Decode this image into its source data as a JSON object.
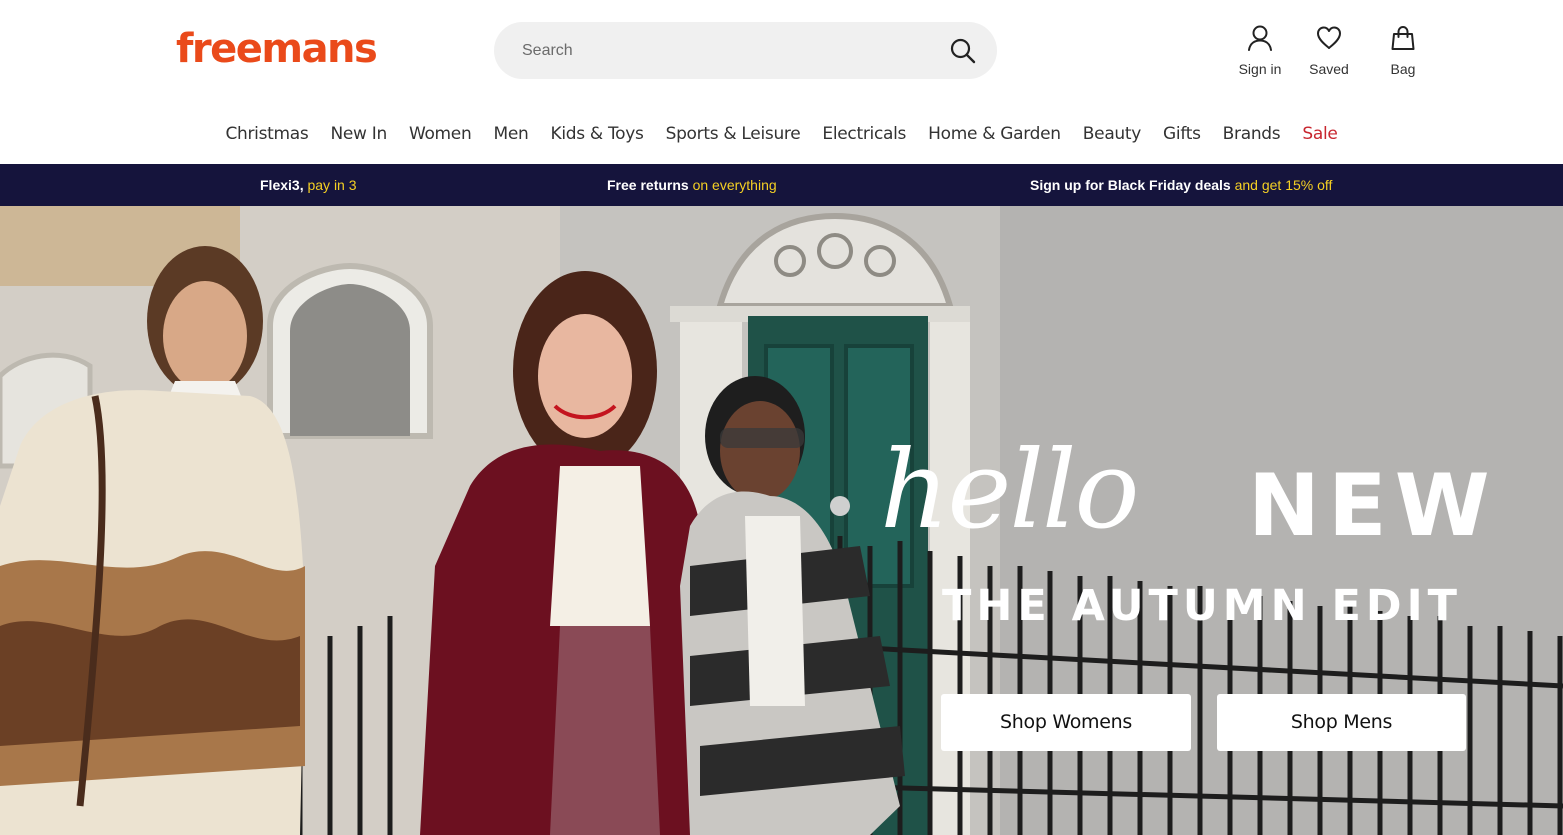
{
  "header": {
    "logo_text": "freemans",
    "search_placeholder": "Search",
    "sign_in_label": "Sign in",
    "saved_label": "Saved",
    "bag_label": "Bag"
  },
  "nav": {
    "items": [
      "Christmas",
      "New In",
      "Women",
      "Men",
      "Kids & Toys",
      "Sports & Leisure",
      "Electricals",
      "Home & Garden",
      "Beauty",
      "Gifts",
      "Brands",
      "Sale"
    ]
  },
  "promo": {
    "flexi_main": "Flexi3,",
    "flexi_highlight": "pay in 3",
    "returns_main": "Free returns",
    "returns_highlight": "on everything",
    "signup_main": "Sign up for Black Friday deals",
    "signup_highlight": "and get 15% off"
  },
  "hero": {
    "headline_script": "hello",
    "headline_bold": "NEW",
    "subtitle": "THE AUTUMN EDIT",
    "cta_women": "Shop Womens",
    "cta_men": "Shop Mens"
  },
  "colors": {
    "brand": "#ea4a1a",
    "promo_bg": "#15143c",
    "promo_highlight": "#f5d024",
    "sale": "#c8262f"
  },
  "icons": [
    "search-icon",
    "user-icon",
    "heart-icon",
    "bag-icon"
  ]
}
